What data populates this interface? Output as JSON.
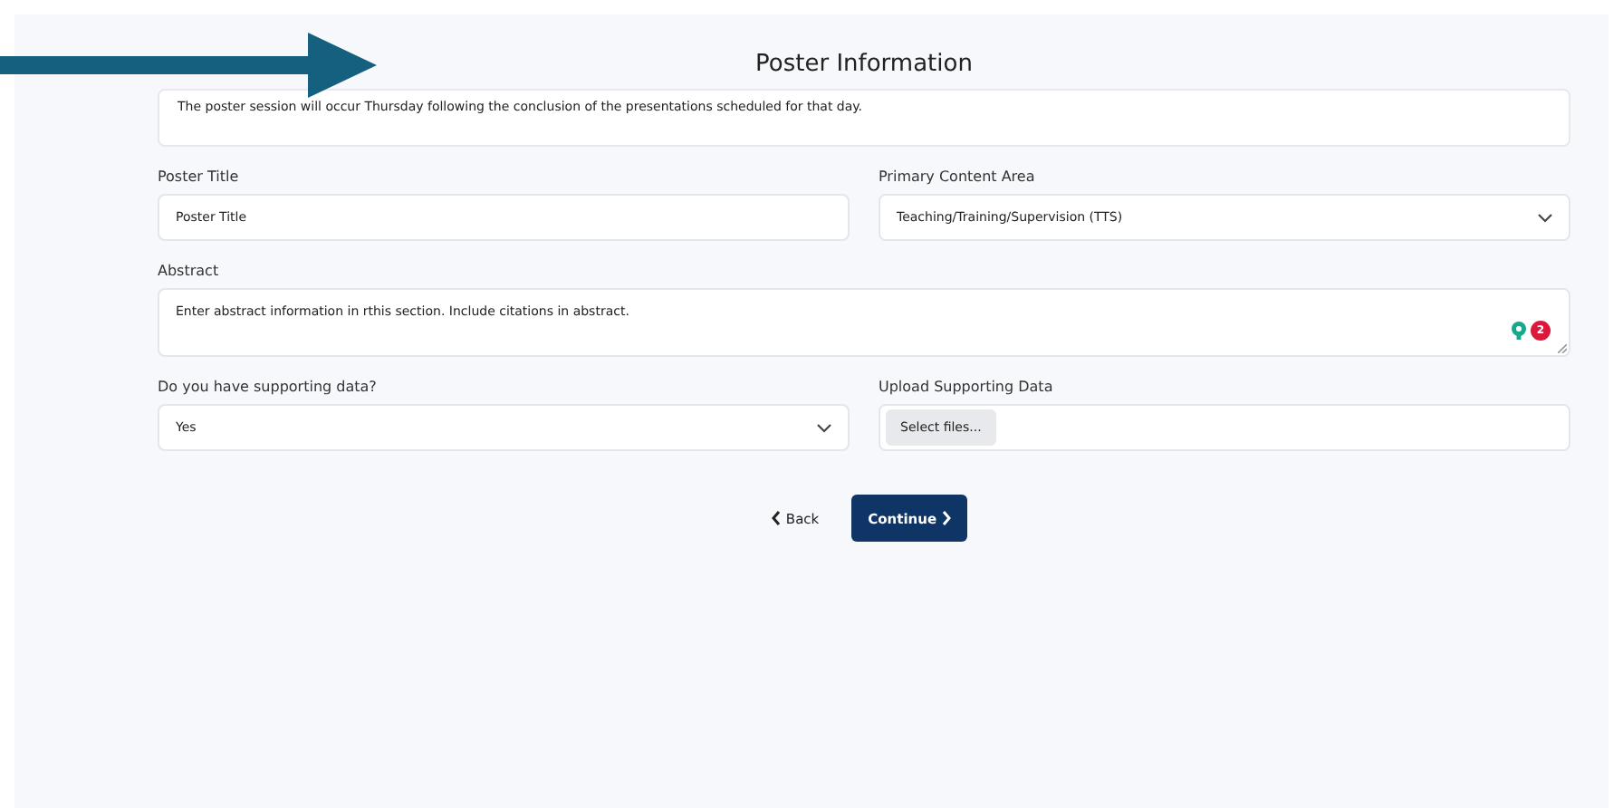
{
  "title": "Poster Information",
  "notice": "The poster session will occur Thursday following the conclusion of the presentations scheduled for that day.",
  "poster_title": {
    "label": "Poster Title",
    "value": "Poster Title"
  },
  "primary_content_area": {
    "label": "Primary Content Area",
    "value": "Teaching/Training/Supervision (TTS)"
  },
  "abstract": {
    "label": "Abstract",
    "value": "Enter abstract information in rthis section. Include citations in abstract.",
    "issue_count": "2"
  },
  "supporting_data": {
    "label": "Do you have supporting data?",
    "value": "Yes"
  },
  "upload": {
    "label": "Upload Supporting Data",
    "button": "Select files..."
  },
  "buttons": [
    {
      "kind": "back",
      "label": "Back"
    },
    {
      "kind": "continue",
      "label": "Continue"
    }
  ]
}
